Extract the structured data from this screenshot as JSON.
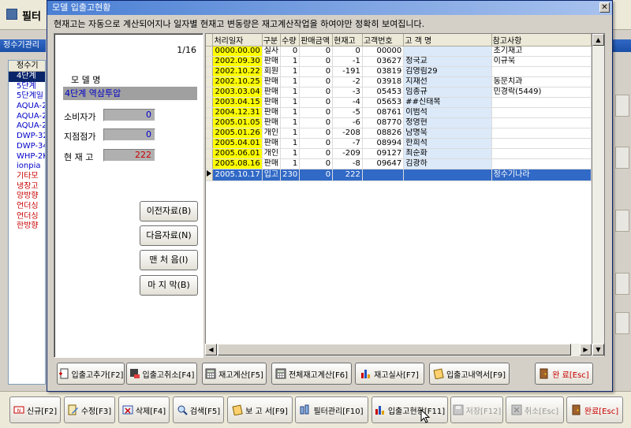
{
  "background": {
    "title": "필터",
    "panel_title": "정수기관리",
    "list_header": "정수기",
    "list_items": [
      {
        "label": "4단계",
        "style": "sel"
      },
      {
        "label": "5단계",
        "style": "blue"
      },
      {
        "label": "5단계일",
        "style": "blue"
      },
      {
        "label": "AQUA-2",
        "style": "blue"
      },
      {
        "label": "AQUA-2",
        "style": "blue"
      },
      {
        "label": "AQUA-2",
        "style": "blue"
      },
      {
        "label": "DWP-32",
        "style": "blue"
      },
      {
        "label": "DWP-34",
        "style": "blue"
      },
      {
        "label": "WHP-2K",
        "style": "blue"
      },
      {
        "label": "ionpia",
        "style": "blue"
      },
      {
        "label": "기타모",
        "style": "red"
      },
      {
        "label": "냉장고",
        "style": "red"
      },
      {
        "label": "양방향",
        "style": "red"
      },
      {
        "label": "언더싱",
        "style": "red"
      },
      {
        "label": "언더싱",
        "style": "red"
      },
      {
        "label": "한방향",
        "style": "red"
      }
    ]
  },
  "modal": {
    "title": "모델 입출고현황",
    "notice": "현재고는 자동으로 계산되어지나 일자별 현재고 변동량은 재고계산작업을 하여야만 정확히 보여집니다.",
    "pager": "1/16",
    "labels": {
      "model": "모 델 명",
      "consumer_price": "소비자가",
      "store_price": "지점점가",
      "stock": "현 재 고"
    },
    "model_name": "4단계 역삼투압",
    "consumer_price": "0",
    "store_price": "0",
    "stock": "222",
    "nav_buttons": {
      "prev": "이전자료(B)",
      "next": "다음자료(N)",
      "first": "맨 처 음(I)",
      "last": "마 지 막(B)"
    },
    "columns": [
      "처리일자",
      "구분",
      "수량",
      "판매금액",
      "현재고",
      "고객번호",
      "고 객 명",
      "참고사항"
    ],
    "rows": [
      {
        "date": "0000.00.00",
        "kind": "실사",
        "qty": "0",
        "amount": "0",
        "stock": "0",
        "cust_no": "00000",
        "cust_name": "",
        "note": "초기재고",
        "selected": false
      },
      {
        "date": "2002.09.30",
        "kind": "판매",
        "qty": "1",
        "amount": "0",
        "stock": "-1",
        "cust_no": "03627",
        "cust_name": "정국교",
        "note": "이규욱",
        "selected": false
      },
      {
        "date": "2002.10.22",
        "kind": "회원",
        "qty": "1",
        "amount": "0",
        "stock": "-191",
        "cust_no": "03819",
        "cust_name": "김영림29",
        "note": "",
        "selected": false
      },
      {
        "date": "2002.10.25",
        "kind": "판매",
        "qty": "1",
        "amount": "0",
        "stock": "-2",
        "cust_no": "03918",
        "cust_name": "지재선",
        "note": "동문치과",
        "selected": false
      },
      {
        "date": "2003.03.04",
        "kind": "판매",
        "qty": "1",
        "amount": "0",
        "stock": "-3",
        "cust_no": "05453",
        "cust_name": "임종규",
        "note": "민경락(5449)",
        "selected": false
      },
      {
        "date": "2003.04.15",
        "kind": "판매",
        "qty": "1",
        "amount": "0",
        "stock": "-4",
        "cust_no": "05653",
        "cust_name": "##신태복",
        "note": "",
        "selected": false
      },
      {
        "date": "2004.12.31",
        "kind": "판매",
        "qty": "1",
        "amount": "0",
        "stock": "-5",
        "cust_no": "08761",
        "cust_name": "이범석",
        "note": "",
        "selected": false
      },
      {
        "date": "2005.01.05",
        "kind": "판매",
        "qty": "1",
        "amount": "0",
        "stock": "-6",
        "cust_no": "08770",
        "cust_name": "정영현",
        "note": "",
        "selected": false
      },
      {
        "date": "2005.01.26",
        "kind": "개인",
        "qty": "1",
        "amount": "0",
        "stock": "-208",
        "cust_no": "08826",
        "cust_name": "남명욱",
        "note": "",
        "selected": false
      },
      {
        "date": "2005.04.01",
        "kind": "판매",
        "qty": "1",
        "amount": "0",
        "stock": "-7",
        "cust_no": "08994",
        "cust_name": "한희석",
        "note": "",
        "selected": false
      },
      {
        "date": "2005.06.01",
        "kind": "개인",
        "qty": "1",
        "amount": "0",
        "stock": "-209",
        "cust_no": "09127",
        "cust_name": "최순화",
        "note": "",
        "selected": false
      },
      {
        "date": "2005.08.16",
        "kind": "판매",
        "qty": "1",
        "amount": "0",
        "stock": "-8",
        "cust_no": "09647",
        "cust_name": "김광하",
        "note": "",
        "selected": false
      },
      {
        "date": "2005.10.17",
        "kind": "입고",
        "qty": "230",
        "amount": "0",
        "stock": "222",
        "cust_no": "",
        "cust_name": "",
        "note": "정수기나라",
        "selected": true
      }
    ],
    "bottom_buttons": [
      {
        "name": "add-inout-button",
        "label": "입출고추가[F2]",
        "icon": "add-doc-icon"
      },
      {
        "name": "cancel-inout-button",
        "label": "입출고취소[F4]",
        "icon": "cancel-doc-icon"
      },
      {
        "name": "stock-calc-button",
        "label": "재고계산[F5]",
        "icon": "calculator-icon"
      },
      {
        "name": "total-stock-calc-button",
        "label": "전체재고계산[F6]",
        "icon": "calculator-icon"
      },
      {
        "name": "stock-audit-button",
        "label": "재고실사[F7]",
        "icon": "bar-chart-icon"
      },
      {
        "name": "inout-history-button",
        "label": "입출고내역서[F9]",
        "icon": "report-icon"
      }
    ],
    "close_label": "완 료[Esc]"
  },
  "toolbar": [
    {
      "name": "new-button",
      "label": "신규[F2]",
      "icon": "new-icon",
      "state": "normal"
    },
    {
      "name": "edit-button",
      "label": "수정[F3]",
      "icon": "edit-icon",
      "state": "normal"
    },
    {
      "name": "delete-button",
      "label": "삭제[F4]",
      "icon": "delete-icon",
      "state": "normal"
    },
    {
      "name": "search-button",
      "label": "검색[F5]",
      "icon": "search-icon",
      "state": "normal"
    },
    {
      "name": "report-button",
      "label": "보 고 서[F9]",
      "icon": "report-icon",
      "state": "normal"
    },
    {
      "name": "filter-manage-button",
      "label": "필터관리[F10]",
      "icon": "filter-icon",
      "state": "normal"
    },
    {
      "name": "inout-status-button",
      "label": "입출고현황[F11]",
      "icon": "bar-chart-icon",
      "state": "normal"
    },
    {
      "name": "save-button",
      "label": "저장[F12]",
      "icon": "save-icon",
      "state": "disabled"
    },
    {
      "name": "cancel-button",
      "label": "취소[Esc]",
      "icon": "cancel-icon",
      "state": "disabled"
    },
    {
      "name": "done-button",
      "label": "완료[Esc]",
      "icon": "door-icon",
      "state": "accent"
    }
  ],
  "colors": {
    "date_cell": "#ffff00",
    "customer_cell": "#dbe9f9",
    "selected_row": "#3169c6",
    "title_bar": "#4a7fd4",
    "price_value": "#0000c8",
    "stock_value": "#c80000"
  }
}
